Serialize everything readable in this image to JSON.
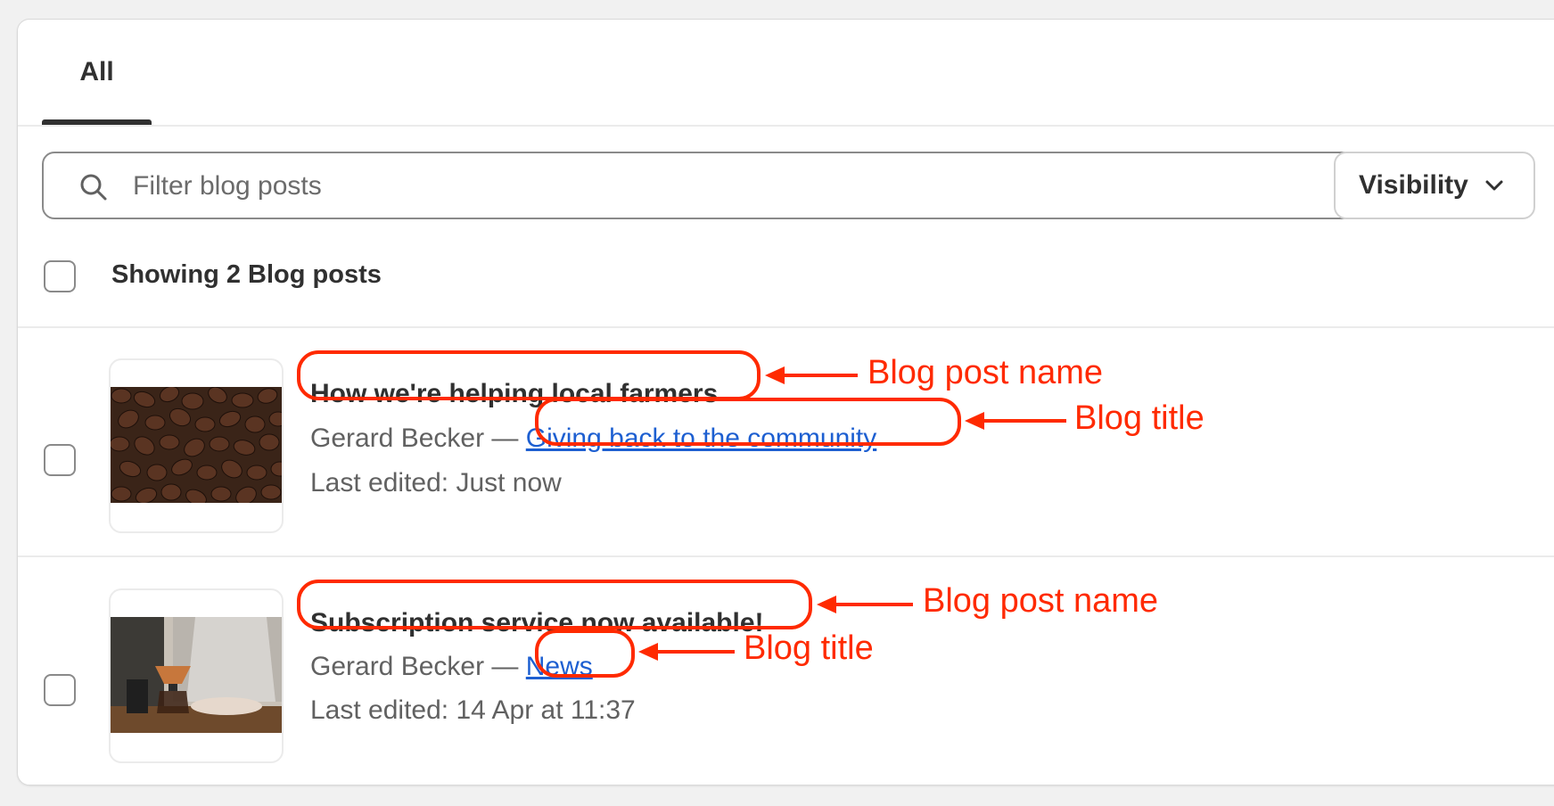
{
  "tabs": [
    {
      "label": "All"
    }
  ],
  "search": {
    "placeholder": "Filter blog posts"
  },
  "filters": {
    "visibility_label": "Visibility"
  },
  "list": {
    "showing_text": "Showing 2 Blog posts"
  },
  "posts": [
    {
      "name": "How we're helping local farmers",
      "author": "Gerard Becker —",
      "blog_title": "Giving back to the community",
      "edited": "Last edited: Just now",
      "thumbnail": "coffee-beans-image"
    },
    {
      "name": "Subscription service now available!",
      "author": "Gerard Becker —",
      "blog_title": "News",
      "edited": "Last edited: 14 Apr at 11:37",
      "thumbnail": "coffee-brewing-image"
    }
  ],
  "annotations": {
    "post_name_label": "Blog post name",
    "blog_title_label": "Blog title",
    "color": "#ff2a00"
  },
  "colors": {
    "link": "#1d5fd1",
    "text": "#303030",
    "muted": "#616161"
  }
}
